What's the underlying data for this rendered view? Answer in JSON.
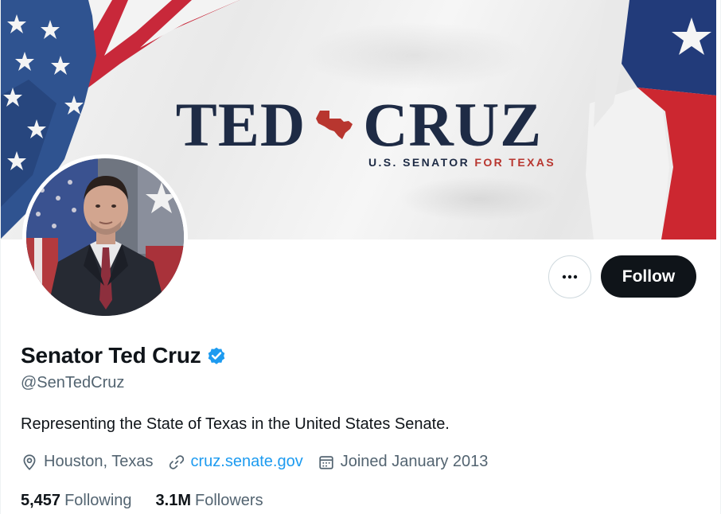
{
  "banner": {
    "title_left": "TED",
    "title_right": "CRUZ",
    "subtitle": "U.S. SENATOR",
    "subtitle_accent": "FOR TEXAS"
  },
  "actions": {
    "more_icon": "more-horizontal-icon",
    "follow_label": "Follow"
  },
  "profile": {
    "display_name": "Senator Ted Cruz",
    "verified_icon": "verified-badge-icon",
    "handle": "@SenTedCruz",
    "bio": "Representing the State of Texas in the United States Senate.",
    "location": "Houston, Texas",
    "website": "cruz.senate.gov",
    "joined": "Joined January 2013"
  },
  "stats": {
    "following_count": "5,457",
    "following_label": "Following",
    "followers_count": "3.1M",
    "followers_label": "Followers"
  },
  "colors": {
    "text": "#0f1419",
    "secondary": "#536471",
    "link": "#1d9bf0",
    "verified": "#1d9bf0",
    "banner_navy": "#1e2b45",
    "banner_red": "#b8362f"
  }
}
